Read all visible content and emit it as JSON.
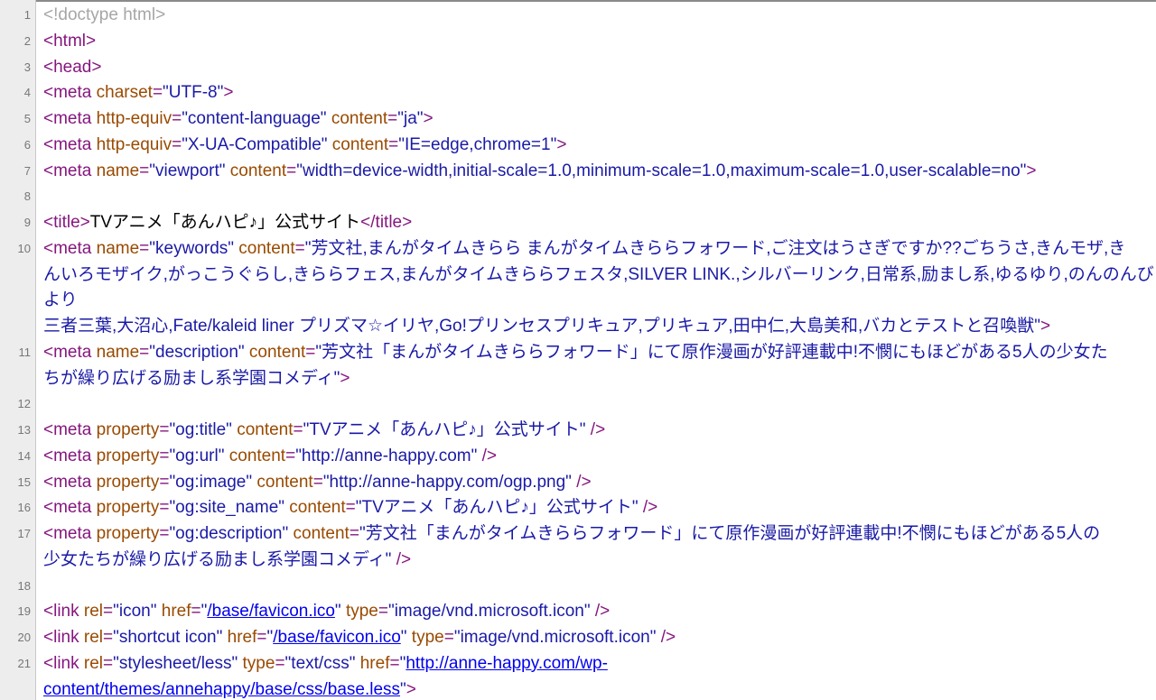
{
  "view": {
    "kind": "view-source",
    "colors": {
      "tag": "#86167f",
      "attribute": "#9a4a00",
      "value": "#1a1aa6",
      "doctype": "#a6a6a6",
      "link": "#0000ee",
      "gutter": "#ededed",
      "text": "#000000"
    }
  },
  "lines": [
    {
      "num": "1",
      "tokens": [
        {
          "t": "doctype",
          "s": "<!doctype html>"
        }
      ]
    },
    {
      "num": "2",
      "tokens": [
        {
          "t": "tag",
          "s": "<html>"
        }
      ]
    },
    {
      "num": "3",
      "tokens": [
        {
          "t": "tag",
          "s": "<head>"
        }
      ]
    },
    {
      "num": "4",
      "tokens": [
        {
          "t": "tag",
          "s": "<meta "
        },
        {
          "t": "attr",
          "s": "charset"
        },
        {
          "t": "tag",
          "s": "="
        },
        {
          "t": "val",
          "s": "\"UTF-8\""
        },
        {
          "t": "tag",
          "s": ">"
        }
      ]
    },
    {
      "num": "5",
      "tokens": [
        {
          "t": "tag",
          "s": "<meta "
        },
        {
          "t": "attr",
          "s": "http-equiv"
        },
        {
          "t": "tag",
          "s": "="
        },
        {
          "t": "val",
          "s": "\"content-language\""
        },
        {
          "t": "tag",
          "s": " "
        },
        {
          "t": "attr",
          "s": "content"
        },
        {
          "t": "tag",
          "s": "="
        },
        {
          "t": "val",
          "s": "\"ja\""
        },
        {
          "t": "tag",
          "s": ">"
        }
      ]
    },
    {
      "num": "6",
      "tokens": [
        {
          "t": "tag",
          "s": "<meta "
        },
        {
          "t": "attr",
          "s": "http-equiv"
        },
        {
          "t": "tag",
          "s": "="
        },
        {
          "t": "val",
          "s": "\"X-UA-Compatible\""
        },
        {
          "t": "tag",
          "s": " "
        },
        {
          "t": "attr",
          "s": "content"
        },
        {
          "t": "tag",
          "s": "="
        },
        {
          "t": "val",
          "s": "\"IE=edge,chrome=1\""
        },
        {
          "t": "tag",
          "s": ">"
        }
      ]
    },
    {
      "num": "7",
      "tokens": [
        {
          "t": "tag",
          "s": "<meta "
        },
        {
          "t": "attr",
          "s": "name"
        },
        {
          "t": "tag",
          "s": "="
        },
        {
          "t": "val",
          "s": "\"viewport\""
        },
        {
          "t": "tag",
          "s": " "
        },
        {
          "t": "attr",
          "s": "content"
        },
        {
          "t": "tag",
          "s": "="
        },
        {
          "t": "val",
          "s": "\"width=device-width,initial-scale=1.0,minimum-scale=1.0,maximum-scale=1.0,user-scalable=no\""
        },
        {
          "t": "tag",
          "s": ">"
        }
      ]
    },
    {
      "num": "8",
      "tokens": []
    },
    {
      "num": "9",
      "nowrap": true,
      "tokens": [
        {
          "t": "tag",
          "s": "<title>"
        },
        {
          "t": "text",
          "s": "TVアニメ「あんハピ♪」公式サイト"
        },
        {
          "t": "tag",
          "s": "</title>"
        }
      ]
    },
    {
      "num": "10",
      "tokens": [
        {
          "t": "tag",
          "s": "<meta "
        },
        {
          "t": "attr",
          "s": "name"
        },
        {
          "t": "tag",
          "s": "="
        },
        {
          "t": "val",
          "s": "\"keywords\""
        },
        {
          "t": "tag",
          "s": " "
        },
        {
          "t": "attr",
          "s": "content"
        },
        {
          "t": "tag",
          "s": "="
        },
        {
          "t": "val",
          "s": "\"芳文社,まんがタイムきらら まんがタイムきららフォワード,ご注文はうさぎですか??ごちうさ,きんモザ,き"
        },
        {
          "t": "break"
        },
        {
          "t": "val",
          "s": "んいろモザイク,がっこうぐらし,きららフェス,まんがタイムきららフェスタ,SILVER LINK.,シルバーリンク,日常系,励まし系,ゆるゆり,のんのんびより"
        },
        {
          "t": "break"
        },
        {
          "t": "val",
          "s": "三者三葉,大沼心,Fate/kaleid liner プリズマ☆イリヤ,Go!プリンセスプリキュア,プリキュア,田中仁,大島美和,バカとテストと召喚獣\""
        },
        {
          "t": "tag",
          "s": ">"
        }
      ]
    },
    {
      "num": "11",
      "tokens": [
        {
          "t": "tag",
          "s": "<meta "
        },
        {
          "t": "attr",
          "s": "name"
        },
        {
          "t": "tag",
          "s": "="
        },
        {
          "t": "val",
          "s": "\"description\""
        },
        {
          "t": "tag",
          "s": " "
        },
        {
          "t": "attr",
          "s": "content"
        },
        {
          "t": "tag",
          "s": "="
        },
        {
          "t": "val",
          "s": "\"芳文社「まんがタイムきららフォワード」にて原作漫画が好評連載中!不憫にもほどがある5人の少女た"
        },
        {
          "t": "break"
        },
        {
          "t": "val",
          "s": "ちが繰り広げる励まし系学園コメディ\""
        },
        {
          "t": "tag",
          "s": ">"
        }
      ]
    },
    {
      "num": "12",
      "tokens": []
    },
    {
      "num": "13",
      "tokens": [
        {
          "t": "tag",
          "s": "<meta "
        },
        {
          "t": "attr",
          "s": "property"
        },
        {
          "t": "tag",
          "s": "="
        },
        {
          "t": "val",
          "s": "\"og:title\""
        },
        {
          "t": "tag",
          "s": " "
        },
        {
          "t": "attr",
          "s": "content"
        },
        {
          "t": "tag",
          "s": "="
        },
        {
          "t": "val",
          "s": "\"TVアニメ「あんハピ♪」公式サイト\""
        },
        {
          "t": "tag",
          "s": " />"
        }
      ]
    },
    {
      "num": "14",
      "tokens": [
        {
          "t": "tag",
          "s": "<meta "
        },
        {
          "t": "attr",
          "s": "property"
        },
        {
          "t": "tag",
          "s": "="
        },
        {
          "t": "val",
          "s": "\"og:url\""
        },
        {
          "t": "tag",
          "s": " "
        },
        {
          "t": "attr",
          "s": "content"
        },
        {
          "t": "tag",
          "s": "="
        },
        {
          "t": "val",
          "s": "\"http://anne-happy.com\""
        },
        {
          "t": "tag",
          "s": " />"
        }
      ]
    },
    {
      "num": "15",
      "tokens": [
        {
          "t": "tag",
          "s": "<meta "
        },
        {
          "t": "attr",
          "s": "property"
        },
        {
          "t": "tag",
          "s": "="
        },
        {
          "t": "val",
          "s": "\"og:image\""
        },
        {
          "t": "tag",
          "s": " "
        },
        {
          "t": "attr",
          "s": "content"
        },
        {
          "t": "tag",
          "s": "="
        },
        {
          "t": "val",
          "s": "\"http://anne-happy.com/ogp.png\""
        },
        {
          "t": "tag",
          "s": " />"
        }
      ]
    },
    {
      "num": "16",
      "tokens": [
        {
          "t": "tag",
          "s": "<meta "
        },
        {
          "t": "attr",
          "s": "property"
        },
        {
          "t": "tag",
          "s": "="
        },
        {
          "t": "val",
          "s": "\"og:site_name\""
        },
        {
          "t": "tag",
          "s": " "
        },
        {
          "t": "attr",
          "s": "content"
        },
        {
          "t": "tag",
          "s": "="
        },
        {
          "t": "val",
          "s": "\"TVアニメ「あんハピ♪」公式サイト\""
        },
        {
          "t": "tag",
          "s": " />"
        }
      ]
    },
    {
      "num": "17",
      "tokens": [
        {
          "t": "tag",
          "s": "<meta "
        },
        {
          "t": "attr",
          "s": "property"
        },
        {
          "t": "tag",
          "s": "="
        },
        {
          "t": "val",
          "s": "\"og:description\""
        },
        {
          "t": "tag",
          "s": " "
        },
        {
          "t": "attr",
          "s": "content"
        },
        {
          "t": "tag",
          "s": "="
        },
        {
          "t": "val",
          "s": "\"芳文社「まんがタイムきららフォワード」にて原作漫画が好評連載中!不憫にもほどがある5人の"
        },
        {
          "t": "break"
        },
        {
          "t": "val",
          "s": "少女たちが繰り広げる励まし系学園コメディ\""
        },
        {
          "t": "tag",
          "s": " />"
        }
      ]
    },
    {
      "num": "18",
      "tokens": []
    },
    {
      "num": "19",
      "tokens": [
        {
          "t": "tag",
          "s": "<link "
        },
        {
          "t": "attr",
          "s": "rel"
        },
        {
          "t": "tag",
          "s": "="
        },
        {
          "t": "val",
          "s": "\"icon\""
        },
        {
          "t": "tag",
          "s": " "
        },
        {
          "t": "attr",
          "s": "href"
        },
        {
          "t": "tag",
          "s": "="
        },
        {
          "t": "val",
          "s": "\""
        },
        {
          "t": "link",
          "s": "/base/favicon.ico"
        },
        {
          "t": "val",
          "s": "\""
        },
        {
          "t": "tag",
          "s": " "
        },
        {
          "t": "attr",
          "s": "type"
        },
        {
          "t": "tag",
          "s": "="
        },
        {
          "t": "val",
          "s": "\"image/vnd.microsoft.icon\""
        },
        {
          "t": "tag",
          "s": " />"
        }
      ]
    },
    {
      "num": "20",
      "tokens": [
        {
          "t": "tag",
          "s": "<link "
        },
        {
          "t": "attr",
          "s": "rel"
        },
        {
          "t": "tag",
          "s": "="
        },
        {
          "t": "val",
          "s": "\"shortcut icon\""
        },
        {
          "t": "tag",
          "s": " "
        },
        {
          "t": "attr",
          "s": "href"
        },
        {
          "t": "tag",
          "s": "="
        },
        {
          "t": "val",
          "s": "\""
        },
        {
          "t": "link",
          "s": "/base/favicon.ico"
        },
        {
          "t": "val",
          "s": "\""
        },
        {
          "t": "tag",
          "s": " "
        },
        {
          "t": "attr",
          "s": "type"
        },
        {
          "t": "tag",
          "s": "="
        },
        {
          "t": "val",
          "s": "\"image/vnd.microsoft.icon\""
        },
        {
          "t": "tag",
          "s": " />"
        }
      ]
    },
    {
      "num": "21",
      "tokens": [
        {
          "t": "tag",
          "s": "<link "
        },
        {
          "t": "attr",
          "s": "rel"
        },
        {
          "t": "tag",
          "s": "="
        },
        {
          "t": "val",
          "s": "\"stylesheet/less\""
        },
        {
          "t": "tag",
          "s": " "
        },
        {
          "t": "attr",
          "s": "type"
        },
        {
          "t": "tag",
          "s": "="
        },
        {
          "t": "val",
          "s": "\"text/css\""
        },
        {
          "t": "tag",
          "s": " "
        },
        {
          "t": "attr",
          "s": "href"
        },
        {
          "t": "tag",
          "s": "="
        },
        {
          "t": "val",
          "s": "\""
        },
        {
          "t": "link",
          "s": "http://anne-happy.com/wp-"
        },
        {
          "t": "break"
        },
        {
          "t": "link",
          "s": "content/themes/annehappy/base/css/base.less"
        },
        {
          "t": "val",
          "s": "\""
        },
        {
          "t": "tag",
          "s": ">"
        }
      ]
    }
  ]
}
